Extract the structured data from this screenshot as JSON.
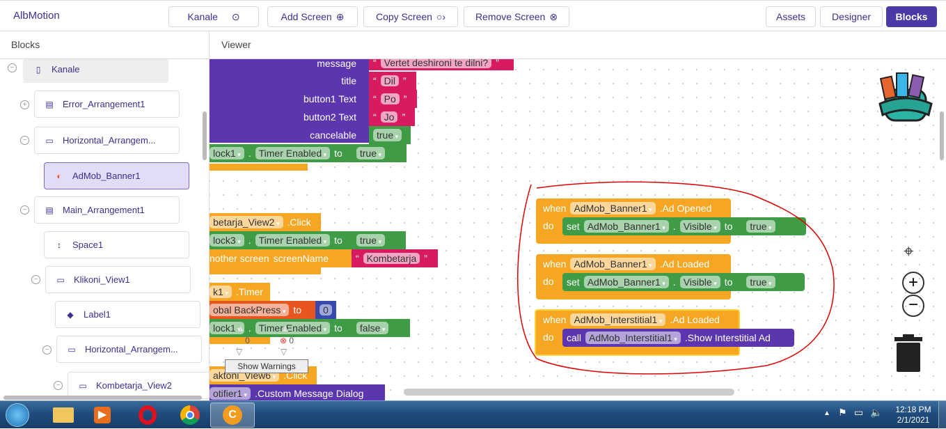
{
  "app": {
    "title": "AlbMotion"
  },
  "toolbar": {
    "screen": "Kanale",
    "add": "Add Screen",
    "copy": "Copy Screen",
    "remove": "Remove Screen",
    "assets": "Assets",
    "designer": "Designer",
    "blocks": "Blocks"
  },
  "panels": {
    "blocks": "Blocks",
    "viewer": "Viewer"
  },
  "tree": [
    {
      "label": "Kanale",
      "icon": "phone-icon"
    },
    {
      "label": "Error_Arrangement1",
      "icon": "vertical-arrangement-icon"
    },
    {
      "label": "Horizontal_Arrangem...",
      "icon": "horizontal-arrangement-icon"
    },
    {
      "label": "AdMob_Banner1",
      "icon": "admob-icon"
    },
    {
      "label": "Main_Arrangement1",
      "icon": "vertical-arrangement-icon"
    },
    {
      "label": "Space1",
      "icon": "space-icon"
    },
    {
      "label": "Klikoni_View1",
      "icon": "view-icon"
    },
    {
      "label": "Label1",
      "icon": "label-icon"
    },
    {
      "label": "Horizontal_Arrangem...",
      "icon": "horizontal-arrangement-icon"
    },
    {
      "label": "Kombetarja_View2",
      "icon": "view-icon"
    }
  ],
  "dialog": {
    "message": "message",
    "message_val": "Vertet deshironi te dilni?",
    "title": "title",
    "title_val": "Dil",
    "b1": "button1 Text",
    "b1_val": "Po",
    "b2": "button2 Text",
    "b2_val": "Jo",
    "cancel": "cancelable",
    "cancel_val": "true"
  },
  "left_blocks": {
    "set1": {
      "comp": "lock1",
      "prop": "Timer Enabled",
      "to": "to",
      "val": "true"
    },
    "ev2": {
      "comp": "betarja_View2",
      "evt": ".Click"
    },
    "set2": {
      "comp": "lock3",
      "prop": "Timer Enabled",
      "to": "to",
      "val": "true"
    },
    "open": {
      "label": "nother screen",
      "param": "screenName",
      "val": "Kombetarja"
    },
    "ev3": {
      "comp": "k1",
      "evt": ".Timer"
    },
    "setg": {
      "var": "obal BackPress",
      "to": "to",
      "val": "0"
    },
    "set3": {
      "comp": "lock1",
      "prop": "Timer Enabled",
      "to": "to",
      "val": "false"
    },
    "ev4": {
      "comp": "aktoni_View6",
      "evt": ".Click"
    },
    "call4": {
      "comp": "otifier1",
      "method": ".Custom Message Dialog"
    }
  },
  "warnings": {
    "warn_count": "0",
    "error_count": "0",
    "button": "Show Warnings"
  },
  "events": [
    {
      "when": "when",
      "comp": "AdMob_Banner1",
      "evt": ".Ad Opened",
      "do": "do",
      "set": "set",
      "target": "AdMob_Banner1",
      "prop": "Visible",
      "to": "to",
      "val": "true"
    },
    {
      "when": "when",
      "comp": "AdMob_Banner1",
      "evt": ".Ad Loaded",
      "do": "do",
      "set": "set",
      "target": "AdMob_Banner1",
      "prop": "Visible",
      "to": "to",
      "val": "true"
    },
    {
      "when": "when",
      "comp": "AdMob_Interstitial1",
      "evt": ".Ad Loaded",
      "do": "do",
      "call": "call",
      "target": "AdMob_Interstitial1",
      "method": ".Show Interstitial Ad"
    }
  ],
  "taskbar": {
    "time": "12:18 PM",
    "date": "2/1/2021"
  },
  "colors": {
    "accent": "#4b3aa6",
    "event": "#f5a623",
    "setter": "#3f9b45",
    "method": "#5b36ae",
    "text": "#d81b60",
    "annotation": "#e00000"
  }
}
